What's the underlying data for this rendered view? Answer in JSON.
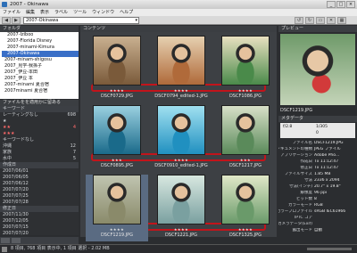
{
  "window": {
    "title": "2007 - Okinawa"
  },
  "menu": [
    "ファイル",
    "編集",
    "表示",
    "ラベル",
    "ツール",
    "ウィンドウ",
    "ヘルプ"
  ],
  "toolbar": {
    "path": "2007-Okinawa"
  },
  "tabs": {
    "folders": "フォルダ",
    "content": "コンテンツ",
    "preview": "プレビュー",
    "meta": "メタデータ"
  },
  "folders": [
    "2007-Iziboo",
    "2007-Florida Disney",
    "2007-minami-Kimura",
    "2007-Okinawa",
    "2007-minam-shigosu",
    "2007_見学-我孫子",
    "2007_伊豆-本田",
    "2007_伊豆 本",
    "2007-minami 夏合宿",
    "2007minami 夏合宿"
  ],
  "keywords": {
    "header": "ファイルをを適用かに留ある",
    "rows": [
      {
        "label": "キーワード",
        "count": "",
        "cls": "hdr"
      },
      {
        "label": "レーティングなし",
        "count": "698",
        "cls": ""
      },
      {
        "label": "★",
        "count": "",
        "cls": ""
      },
      {
        "label": "★★",
        "count": "4",
        "cls": "red"
      },
      {
        "label": "★★★",
        "count": "",
        "cls": "red"
      },
      {
        "label": "キーワードなし",
        "count": "",
        "cls": ""
      },
      {
        "label": "沖縄",
        "count": "12",
        "cls": ""
      },
      {
        "label": "家族",
        "count": "7",
        "cls": ""
      },
      {
        "label": "水中",
        "count": "5",
        "cls": ""
      },
      {
        "label": "作成日",
        "count": "",
        "cls": "hdr"
      },
      {
        "label": "2007/06/01",
        "count": "",
        "cls": ""
      },
      {
        "label": "2007/06/05",
        "count": "",
        "cls": ""
      },
      {
        "label": "2007/06/12",
        "count": "",
        "cls": ""
      },
      {
        "label": "2007/07/20",
        "count": "",
        "cls": ""
      },
      {
        "label": "2007/07/25",
        "count": "",
        "cls": ""
      },
      {
        "label": "2007/07/28",
        "count": "",
        "cls": ""
      },
      {
        "label": "修正日",
        "count": "",
        "cls": "hdr"
      },
      {
        "label": "2007/11/30",
        "count": "",
        "cls": ""
      },
      {
        "label": "2007/12/05",
        "count": "",
        "cls": ""
      },
      {
        "label": "2007/07/15",
        "count": "",
        "cls": ""
      },
      {
        "label": "2007/07/20",
        "count": "",
        "cls": ""
      }
    ]
  },
  "thumbs": [
    {
      "name": "DSCF0729.JPG",
      "stars": "★★★★",
      "c1": "#7a5a3a",
      "c2": "#c9b090"
    },
    {
      "name": "DSCF0794_edited-1.JPG",
      "stars": "★★★★",
      "c1": "#b06a3a",
      "c2": "#e6d0b0"
    },
    {
      "name": "DSCF1086.JPG",
      "stars": "★★★★",
      "c1": "#4a8a4a",
      "c2": "#e8e0c0"
    },
    {
      "name": "DSCF0895.JPG",
      "stars": "★★★",
      "c1": "#1a6a8a",
      "c2": "#9ad0e0"
    },
    {
      "name": "DSCF0910_edited-1.JPG",
      "stars": "★★★★",
      "c1": "#2090c0",
      "c2": "#a0e0f0"
    },
    {
      "name": "DSCF1217.JPG",
      "stars": "★★★",
      "c1": "#5a8a5a",
      "c2": "#d8e0c8"
    },
    {
      "name": "DSCF1219.JPG",
      "stars": "★★★★",
      "c1": "#8a8a6a",
      "c2": "#c0c4b0",
      "sel": true
    },
    {
      "name": "DSCF1221.JPG",
      "stars": "★★★★",
      "c1": "#7aa0a0",
      "c2": "#d8e8e0"
    },
    {
      "name": "DSCF1325.JPG",
      "stars": "★★★★",
      "c1": "#6a9a6a",
      "c2": "#e0e8c8"
    }
  ],
  "preview": {
    "caption": "DSCF1219.JPG"
  },
  "meta": {
    "fnum": "f/2.8",
    "shutter": "1/305",
    "mode": "0",
    "rows": [
      {
        "k": "ファイル名",
        "v": "DSCF1219.JPG"
      },
      {
        "k": "ドキュメントの種類",
        "v": "JPEG ファイル"
      },
      {
        "k": "アプリケーション",
        "v": "Adobe Pho..."
      },
      {
        "k": "作成日",
        "v": "Tx 11:12:47"
      },
      {
        "k": "修正日",
        "v": "Tx 11:12:47"
      },
      {
        "k": "ファイルサイズ",
        "v": "1.85 MB"
      },
      {
        "k": "寸法",
        "v": "2336 x 2094"
      },
      {
        "k": "寸法(インチ)",
        "v": "20.7\" x 19.8\""
      },
      {
        "k": "解像度",
        "v": "96 ppi"
      },
      {
        "k": "ビット数",
        "v": "8"
      },
      {
        "k": "カラーモード",
        "v": "RGB"
      },
      {
        "k": "カラープロファイル",
        "v": "sRGB IEC61966"
      },
      {
        "k": "IPTC コア",
        "v": ""
      },
      {
        "k": "カメラデータ(Exif)",
        "v": ""
      },
      {
        "k": "露出モード",
        "v": "自動"
      }
    ]
  },
  "status": {
    "text": "8 項目, 768 項目 表示中, 1 項目 選択 - 2.02 MB"
  }
}
